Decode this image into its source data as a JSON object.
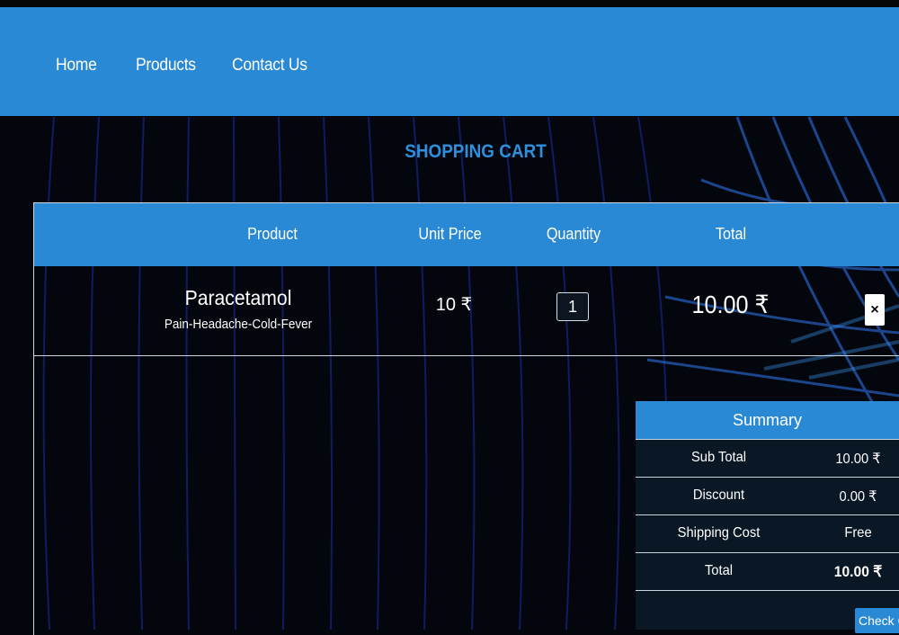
{
  "nav": {
    "items": [
      {
        "label": "Home"
      },
      {
        "label": "Products"
      },
      {
        "label": "Contact Us"
      }
    ]
  },
  "page_title": "SHOPPING CART",
  "table": {
    "headers": {
      "product": "Product",
      "unit_price": "Unit Price",
      "quantity": "Quantity",
      "total": "Total"
    },
    "items": [
      {
        "name": "Paracetamol",
        "description": "Pain-Headache-Cold-Fever",
        "unit_price": "10 ₹",
        "quantity": "1",
        "total": "10.00 ₹",
        "remove_label": "×"
      }
    ]
  },
  "summary": {
    "title": "Summary",
    "rows": [
      {
        "label": "Sub Total",
        "value": "10.00 ₹"
      },
      {
        "label": "Discount",
        "value": "0.00 ₹"
      },
      {
        "label": "Shipping Cost",
        "value": "Free"
      },
      {
        "label": "Total",
        "value": "10.00 ₹"
      }
    ],
    "checkout_label": "Check Out"
  },
  "colors": {
    "accent": "#2a89d4",
    "title": "#2e8fdc",
    "background": "#03060d",
    "summary_bg": "#0a1825"
  }
}
